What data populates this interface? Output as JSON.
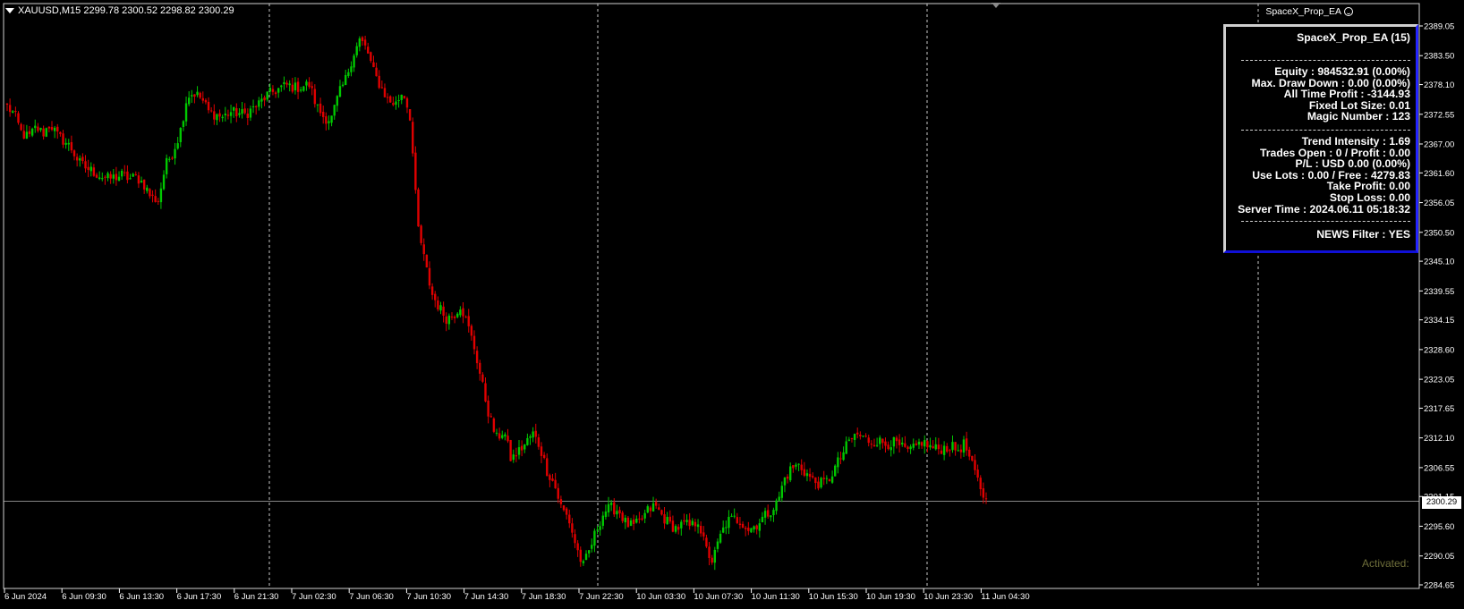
{
  "symbol_header": {
    "text": "XAUUSD,M15  2299.78 2300.52 2298.82 2300.29"
  },
  "ea_label": "SpaceX_Prop_EA",
  "panel": {
    "title": "SpaceX_Prop_EA (15)",
    "lines_group1": [
      "Equity : 984532.91 (0.00%)",
      "Max. Draw Down : 0.00 (0.00%)",
      "All Time Profit : -3144.93",
      "Fixed Lot Size: 0.01",
      "Magic Number : 123"
    ],
    "lines_group2": [
      "Trend Intensity : 1.69",
      "Trades Open : 0 / Profit : 0.00",
      "P/L : USD 0.00 (0.00%)",
      "Use Lots : 0.00 / Free : 4279.83",
      "Take Profit: 0.00",
      "Stop Loss: 0.00",
      "Server Time : 2024.06.11 05:18:32"
    ],
    "news_filter": "NEWS Filter : YES"
  },
  "activated_label": "Activated:",
  "current_price": "2300.29",
  "colors": {
    "bull": "#00c800",
    "bear": "#e00000",
    "grid": "#c8c8c8",
    "axis": "#ffffff",
    "panel_border": "#1a1aff"
  },
  "chart_data": {
    "type": "candlestick",
    "symbol": "XAUUSD",
    "timeframe": "M15",
    "y_ticks": [
      "2389.05",
      "2383.50",
      "2378.10",
      "2372.55",
      "2367.00",
      "2361.60",
      "2356.05",
      "2350.50",
      "2345.10",
      "2339.55",
      "2334.15",
      "2328.60",
      "2323.05",
      "2317.65",
      "2312.10",
      "2306.55",
      "2301.15",
      "2295.60",
      "2290.05",
      "2284.65"
    ],
    "y_range": [
      2284.65,
      2389.05
    ],
    "x_ticks": [
      "6 Jun 2024",
      "6 Jun 09:30",
      "6 Jun 13:30",
      "6 Jun 17:30",
      "6 Jun 21:30",
      "7 Jun 02:30",
      "7 Jun 06:30",
      "7 Jun 10:30",
      "7 Jun 14:30",
      "7 Jun 18:30",
      "7 Jun 22:30",
      "10 Jun 03:30",
      "10 Jun 07:30",
      "10 Jun 11:30",
      "10 Jun 15:30",
      "10 Jun 19:30",
      "10 Jun 23:30",
      "11 Jun 04:30"
    ],
    "current_price": 2300.29,
    "series_close": [
      2374.0,
      2372.5,
      2369.0,
      2368.2,
      2370.1,
      2369.0,
      2370.8,
      2368.5,
      2367.5,
      2366.0,
      2363.5,
      2362.5,
      2361.8,
      2361.0,
      2360.5,
      2360.8,
      2361.2,
      2360.5,
      2360.8,
      2359.5,
      2357.0,
      2356.5,
      2363.0,
      2365.5,
      2369.0,
      2376.0,
      2376.5,
      2375.5,
      2373.0,
      2372.5,
      2372.0,
      2373.0,
      2372.8,
      2372.5,
      2373.5,
      2374.5,
      2376.0,
      2376.8,
      2377.5,
      2378.0,
      2377.5,
      2377.8,
      2378.1,
      2374.0,
      2372.0,
      2371.5,
      2376.0,
      2379.0,
      2383.5,
      2386.5,
      2384.5,
      2380.0,
      2377.5,
      2375.0,
      2374.5,
      2377.0,
      2372.0,
      2352.0,
      2345.0,
      2339.0,
      2336.5,
      2334.5,
      2335.0,
      2337.0,
      2333.0,
      2328.5,
      2322.0,
      2316.0,
      2312.0,
      2313.5,
      2308.0,
      2309.5,
      2311.0,
      2313.0,
      2310.5,
      2306.0,
      2303.5,
      2299.0,
      2297.0,
      2292.0,
      2288.0,
      2291.5,
      2295.5,
      2298.5,
      2299.0,
      2298.5,
      2296.0,
      2295.5,
      2296.5,
      2298.5,
      2299.5,
      2297.5,
      2296.0,
      2295.2,
      2296.0,
      2295.5,
      2296.8,
      2291.5,
      2289.0,
      2293.5,
      2296.5,
      2297.0,
      2296.5,
      2295.0,
      2295.8,
      2297.2,
      2298.5,
      2300.0,
      2304.5,
      2306.5,
      2307.0,
      2305.5,
      2304.0,
      2303.5,
      2304.0,
      2306.5,
      2309.0,
      2311.5,
      2312.8,
      2312.0,
      2311.5,
      2311.5,
      2311.0,
      2311.3,
      2310.5,
      2309.5,
      2310.0,
      2311.5,
      2310.5,
      2310.0,
      2310.2,
      2310.5,
      2309.8,
      2311.0,
      2307.0,
      2303.5,
      2300.3
    ]
  }
}
